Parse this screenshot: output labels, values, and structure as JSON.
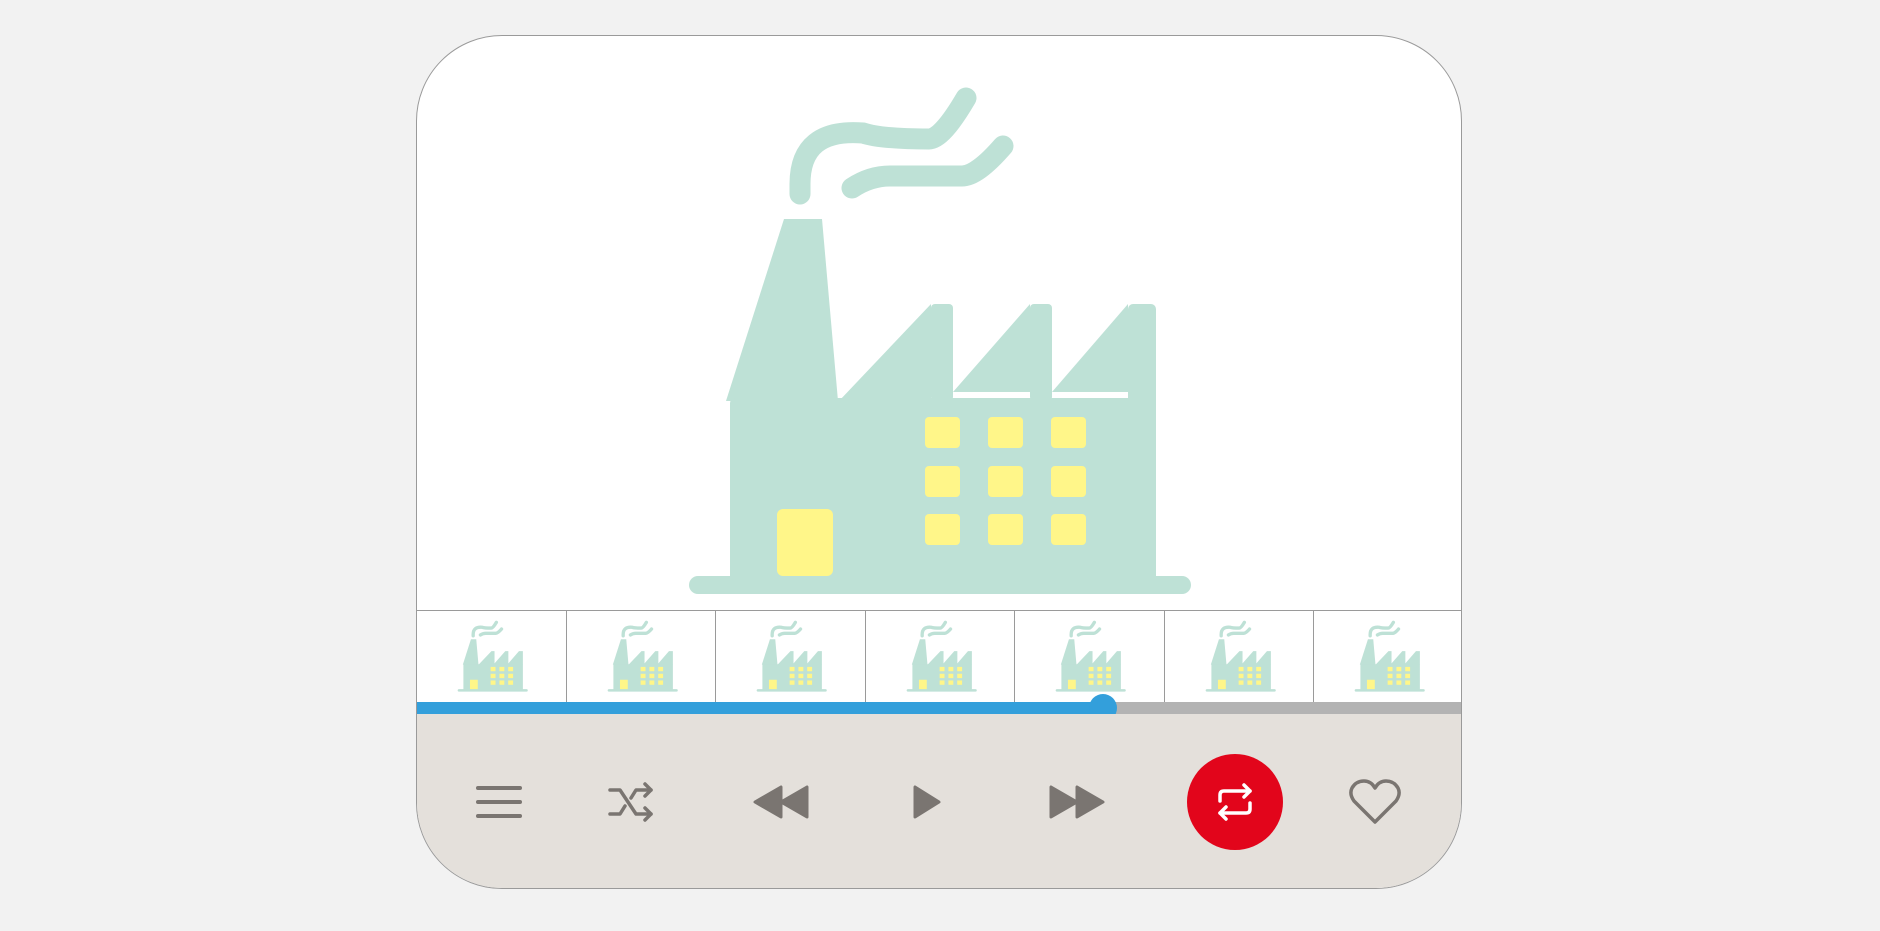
{
  "player": {
    "artwork_icon": "factory-icon",
    "thumbnail_count": 7,
    "thumbnail_icon": "factory-icon",
    "progress_fraction": 0.656,
    "colors": {
      "factory_body": "#bee1d6",
      "factory_windows": "#fff689",
      "progress_played": "#339fdb",
      "progress_remaining": "#b3b3b3",
      "controls_background": "#e4e0db",
      "icon_gray": "#7a7571",
      "repeat_active": "#e2051b"
    }
  },
  "controls": [
    {
      "name": "menu-button",
      "icon": "hamburger-menu-icon"
    },
    {
      "name": "shuffle-button",
      "icon": "shuffle-icon"
    },
    {
      "name": "rewind-button",
      "icon": "rewind-icon"
    },
    {
      "name": "play-button",
      "icon": "play-icon"
    },
    {
      "name": "fast-forward-button",
      "icon": "fast-forward-icon"
    },
    {
      "name": "repeat-button",
      "icon": "repeat-icon",
      "active": true
    },
    {
      "name": "favorite-button",
      "icon": "heart-icon"
    }
  ]
}
